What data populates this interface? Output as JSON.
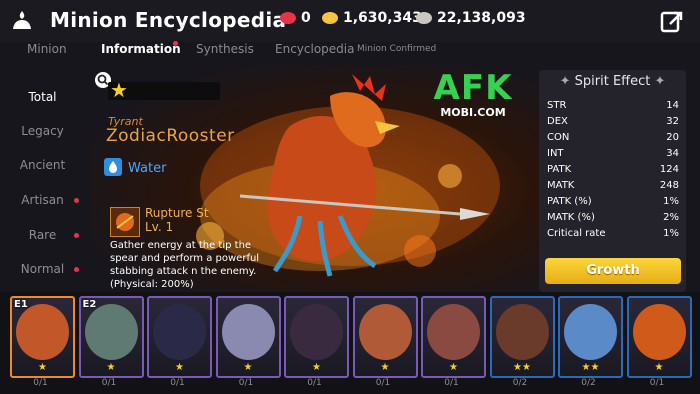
{
  "header": {
    "title": "Minion Encyclopedia",
    "currencies": [
      {
        "icon": "ruby-icon",
        "value": "0",
        "color": "#e8334a"
      },
      {
        "icon": "gold-coin-icon",
        "value": "1,630,343",
        "color": "#f5c542"
      },
      {
        "icon": "silver-coin-icon",
        "value": "22,138,093",
        "color": "#c9c7bf"
      }
    ]
  },
  "tabs": [
    {
      "label": "Minion"
    },
    {
      "label": "Information"
    },
    {
      "label": "Synthesis"
    },
    {
      "label": "Encyclopedia"
    },
    {
      "label": "Minion Confirmed"
    }
  ],
  "sidebar": {
    "items": [
      {
        "label": "Total"
      },
      {
        "label": "Legacy"
      },
      {
        "label": "Ancient"
      },
      {
        "label": "Artisan"
      },
      {
        "label": "Rare"
      },
      {
        "label": "Normal"
      }
    ]
  },
  "minion": {
    "stars": "★",
    "tier": "Tyrant",
    "name": "ZodiacRooster",
    "element": "Water",
    "skill": {
      "name": "Rupture St",
      "level": "Lv. 1",
      "description": "Gather energy at the tip the spear and perform a powerful stabbing attack n the enemy. (Physical: 200%)"
    }
  },
  "watermark": {
    "logo": "AFK",
    "sub": "MOBI.COM"
  },
  "spirit": {
    "title": "Spirit Effect",
    "stats": [
      {
        "name": "STR",
        "value": "14"
      },
      {
        "name": "DEX",
        "value": "32"
      },
      {
        "name": "CON",
        "value": "20"
      },
      {
        "name": "INT",
        "value": "34"
      },
      {
        "name": "PATK",
        "value": "124"
      },
      {
        "name": "MATK",
        "value": "248"
      },
      {
        "name": "PATK (%)",
        "value": "1%"
      },
      {
        "name": "MATK (%)",
        "value": "2%"
      },
      {
        "name": "Critical rate",
        "value": "1%"
      }
    ]
  },
  "growth_label": "Growth",
  "cards": [
    {
      "badge": "E1",
      "stars": "★",
      "count": "0/1",
      "border": "#f08a2a",
      "color": "#c2572a"
    },
    {
      "badge": "E2",
      "stars": "★",
      "count": "0/1",
      "border": "#7a5ab8",
      "color": "#5e7a72"
    },
    {
      "badge": "",
      "stars": "★",
      "count": "0/1",
      "border": "#7a5ab8",
      "color": "#2a2a48"
    },
    {
      "badge": "",
      "stars": "★",
      "count": "0/1",
      "border": "#7a5ab8",
      "color": "#8a8ab0"
    },
    {
      "badge": "",
      "stars": "★",
      "count": "0/1",
      "border": "#7a5ab8",
      "color": "#3a2a40"
    },
    {
      "badge": "",
      "stars": "★",
      "count": "0/1",
      "border": "#7a5ab8",
      "color": "#b05a38"
    },
    {
      "badge": "",
      "stars": "★",
      "count": "0/1",
      "border": "#7a5ab8",
      "color": "#8a4a42"
    },
    {
      "badge": "",
      "stars": "★★",
      "count": "0/2",
      "border": "#2a6ab8",
      "color": "#6a3a2a"
    },
    {
      "badge": "",
      "stars": "★★",
      "count": "0/2",
      "border": "#2a6ab8",
      "color": "#5a8ac8"
    },
    {
      "badge": "",
      "stars": "★",
      "count": "0/1",
      "border": "#2a6ab8",
      "color": "#d05a1a"
    }
  ]
}
